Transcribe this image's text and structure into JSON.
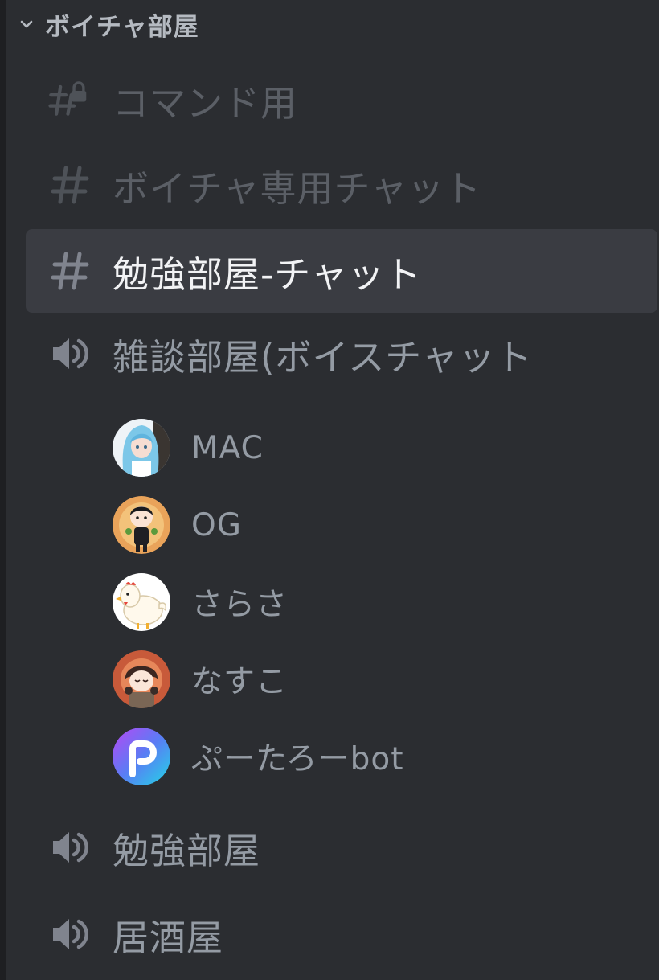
{
  "category": {
    "name": "ボイチャ部屋",
    "icon": "chevron-down-icon"
  },
  "text_channels": [
    {
      "name": "コマンド用",
      "icon": "locked-hash-icon",
      "state": "muted"
    },
    {
      "name": "ボイチャ専用チャット",
      "icon": "hash-icon",
      "state": "muted"
    },
    {
      "name": "勉強部屋-チャット",
      "icon": "hash-icon",
      "state": "active"
    }
  ],
  "voice_channels": [
    {
      "name": "雑談部屋(ボイスチャット",
      "icon": "speaker-icon"
    },
    {
      "name": "勉強部屋",
      "icon": "speaker-icon"
    },
    {
      "name": "居酒屋",
      "icon": "speaker-icon"
    }
  ],
  "voice_users": [
    {
      "name": "MAC",
      "avatar": "anime-girl-avatar"
    },
    {
      "name": "OG",
      "avatar": "chibi-boy-avatar"
    },
    {
      "name": "さらさ",
      "avatar": "chicken-avatar"
    },
    {
      "name": "なすこ",
      "avatar": "chibi-girl-avatar"
    },
    {
      "name": "ぷーたろーbot",
      "avatar": "p-logo-avatar"
    }
  ],
  "colors": {
    "background": "#2b2d31",
    "active_row": "#3a3c42",
    "text_muted": "#949ba4",
    "text_active": "#f2f3f5"
  }
}
